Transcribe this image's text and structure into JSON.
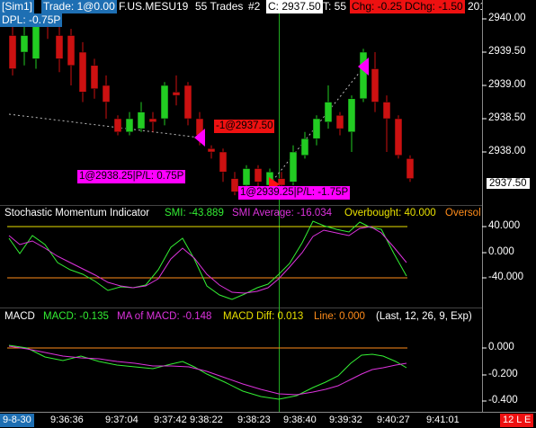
{
  "header": {
    "account": "[Sim1]",
    "trade": "Trade: 1@0.00",
    "instrument": "F.US.MESU19",
    "trades": "55 Trades",
    "bar": "#2",
    "close": "C: 2937.50",
    "ticks": "T: 55",
    "chg": "Chg: -0.25",
    "dchg": "DChg: -1.50",
    "date_part": "201",
    "dpl": "DPL: -0.75P"
  },
  "price_axis": [
    "2940.00",
    "2939.50",
    "2939.00",
    "2938.50",
    "2938.00"
  ],
  "price_tag": "2937.50",
  "trade_labels": {
    "sell": "-1@2937.50",
    "buy1": "1@2938.25|P/L: 0.75P",
    "buy2": "1@2939.25|P/L: -1.75P"
  },
  "smi": {
    "title": "Stochastic Momentum Indicator",
    "smi": "SMI: -43.889",
    "avg": "SMI Average: -16.034",
    "ob": "Overbought: 40.000",
    "os": "Oversol",
    "axis": [
      "40.000",
      "0.000",
      "-40.000"
    ]
  },
  "macd": {
    "title": "MACD",
    "macd": "MACD: -0.135",
    "ma": "MA of MACD: -0.148",
    "diff": "MACD Diff: 0.013",
    "line": "Line: 0.000",
    "params": "(Last, 12, 26, 9, Exp)",
    "axis": [
      "0.000",
      "-0.200",
      "-0.400"
    ]
  },
  "time_axis": {
    "date": "9-8-30",
    "ticks": [
      "9:36:36",
      "9:37:04",
      "9:37:42",
      "9:38:22",
      "9:38:23",
      "9:38:40",
      "9:39:32",
      "9:40:27",
      "9:41:01"
    ],
    "badge": "12 L E"
  },
  "colors": {
    "up": "#22cc22",
    "down": "#cc1111",
    "smi": "#33ee33",
    "avg": "#dd33dd",
    "ob": "#e8e000",
    "os": "#ff8c1a",
    "magenta": "#ff00ff"
  }
}
